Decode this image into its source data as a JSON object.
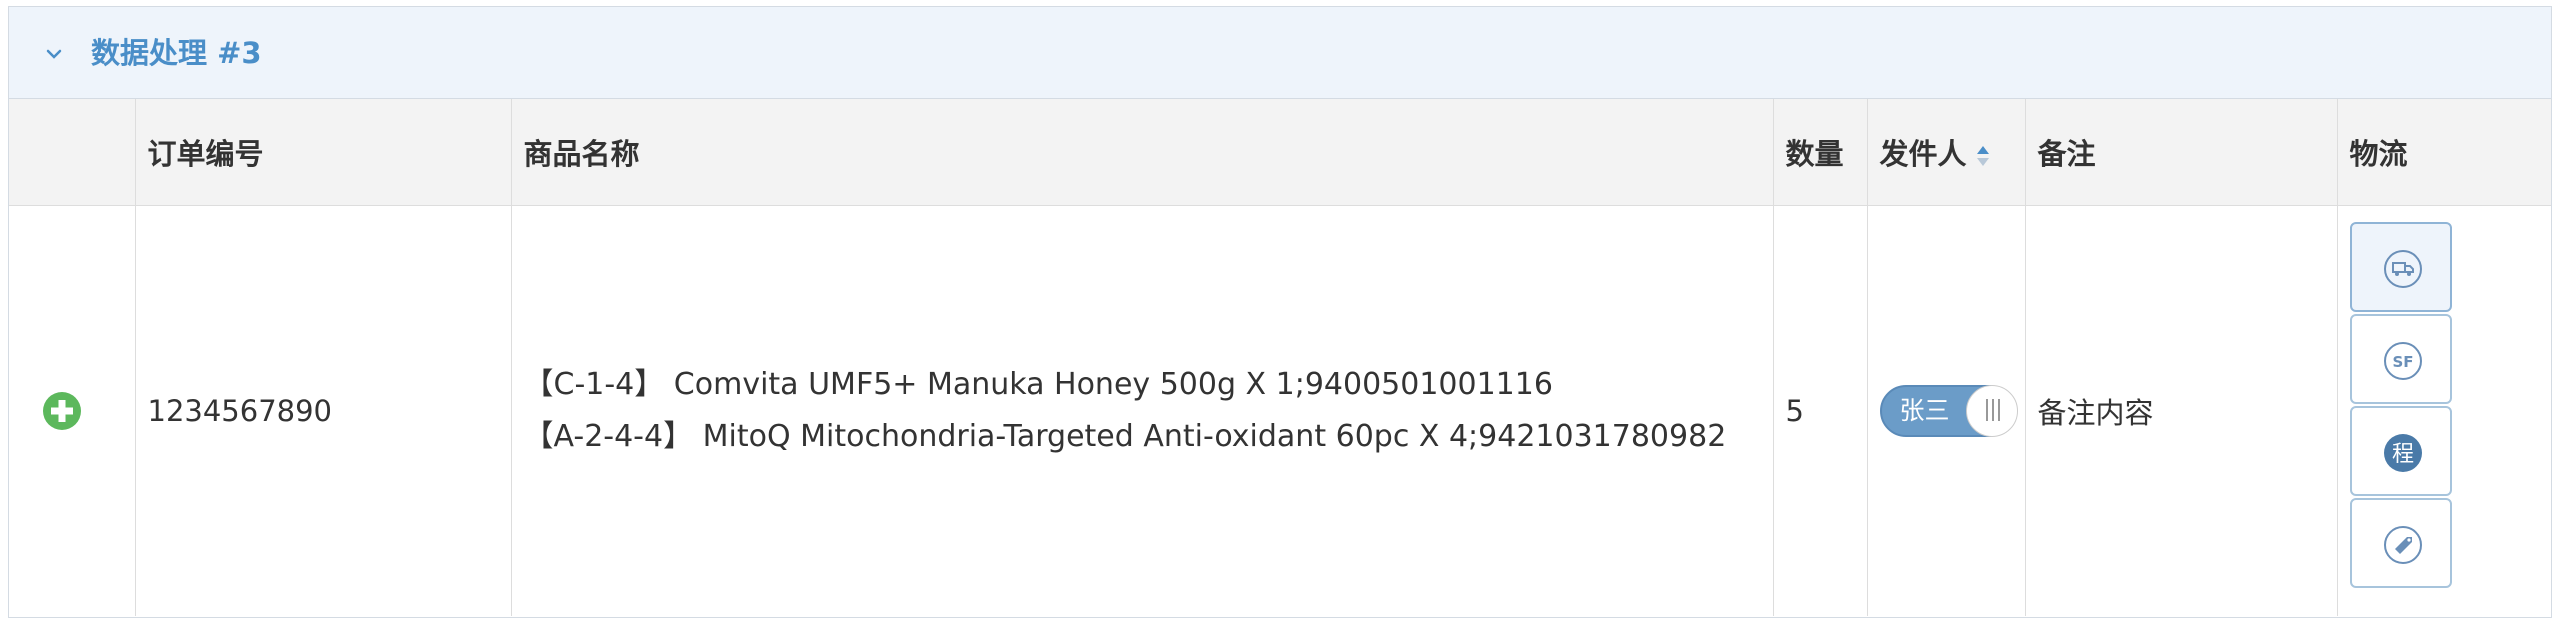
{
  "panel": {
    "title": "数据处理 #3",
    "chevron_icon": "chevron-down-icon"
  },
  "table": {
    "columns": [
      "订单编号",
      "商品名称",
      "数量",
      "发件人",
      "备注",
      "物流"
    ],
    "rows": [
      {
        "order_id": "1234567890",
        "products": [
          "【C-1-4】 Comvita UMF5+ Manuka Honey 500g X  1;9400501001116",
          "【A-2-4-4】 MitoQ Mitochondria-Targeted Anti-oxidant 60pc X  4;9421031780982"
        ],
        "quantity": "5",
        "sender": "张三",
        "remark": "备注内容",
        "logistics_buttons": [
          {
            "icon": "truck-icon"
          },
          {
            "icon": "sf-express-icon",
            "text": "SF"
          },
          {
            "icon": "cheng-icon",
            "text": "程"
          },
          {
            "icon": "tag-icon"
          }
        ]
      }
    ]
  },
  "colors": {
    "title": "#4a8ec8",
    "header_bg": "#eef4fb",
    "plus_icon": "#5cb85c",
    "toggle_on": "#6b9cc8",
    "logistics_icon": "#4a7aa8"
  }
}
